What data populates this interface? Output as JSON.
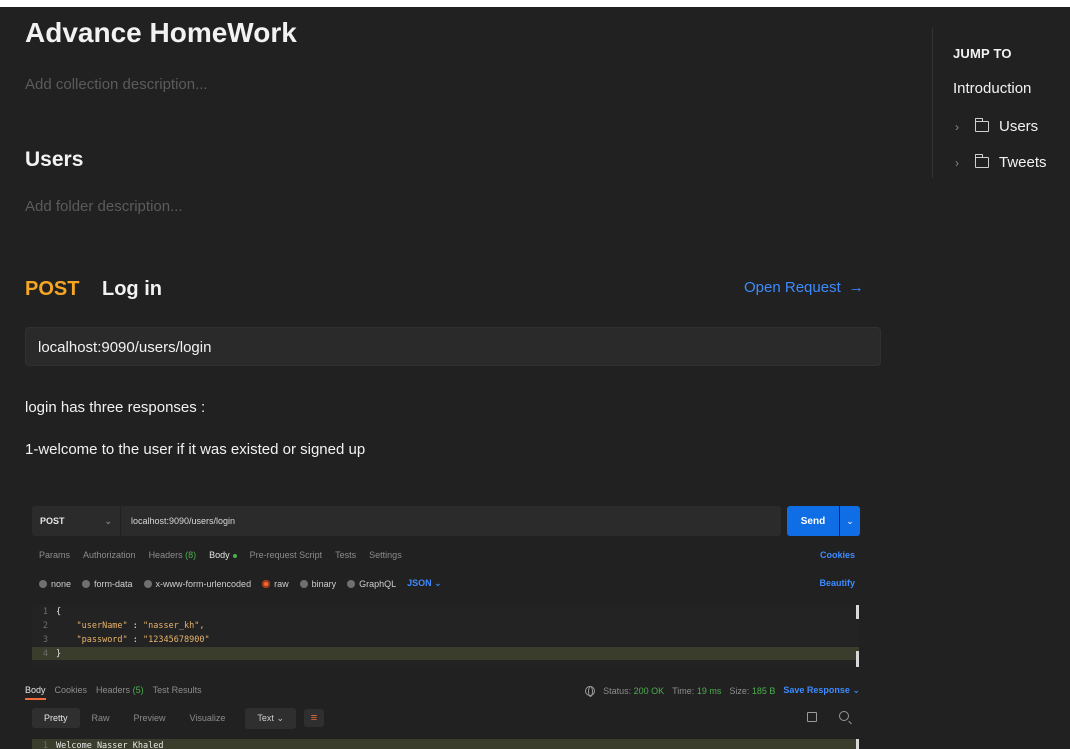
{
  "collection": {
    "title": "Advance HomeWork",
    "description_placeholder": "Add collection description..."
  },
  "folder": {
    "title": "Users",
    "description_placeholder": "Add folder description..."
  },
  "request": {
    "method": "POST",
    "name": "Log in",
    "open_label": "Open Request",
    "open_arrow": "→",
    "url": "localhost:9090/users/login",
    "description": [
      "login has three responses :",
      "1-welcome to the user if it was existed or signed up"
    ]
  },
  "sidebar": {
    "title": "JUMP TO",
    "intro": "Introduction",
    "items": [
      {
        "label": "Users"
      },
      {
        "label": "Tweets"
      }
    ]
  },
  "screenshot": {
    "method": "POST",
    "url": "localhost:9090/users/login",
    "send": "Send",
    "tabs": [
      {
        "label": "Params"
      },
      {
        "label": "Authorization"
      },
      {
        "label": "Headers",
        "count": "(8)"
      },
      {
        "label": "Body"
      },
      {
        "label": "Pre-request Script"
      },
      {
        "label": "Tests"
      },
      {
        "label": "Settings"
      }
    ],
    "cookies": "Cookies",
    "body_types": [
      "none",
      "form-data",
      "x-www-form-urlencoded",
      "raw",
      "binary",
      "GraphQL"
    ],
    "format": "JSON",
    "beautify": "Beautify",
    "code_lines": [
      {
        "n": "1",
        "text": "{"
      },
      {
        "n": "2",
        "key": "\"userName\"",
        "value": "\"nasser_kh\","
      },
      {
        "n": "3",
        "key": "\"password\"",
        "value": "\"12345678900\""
      },
      {
        "n": "4",
        "text": "}"
      }
    ],
    "resp_tabs": [
      {
        "label": "Body"
      },
      {
        "label": "Cookies"
      },
      {
        "label": "Headers",
        "count": "(5)"
      },
      {
        "label": "Test Results"
      }
    ],
    "status_label": "Status:",
    "status_value": "200 OK",
    "time_label": "Time:",
    "time_value": "19 ms",
    "size_label": "Size:",
    "size_value": "185 B",
    "save_response": "Save Response",
    "views": [
      "Pretty",
      "Raw",
      "Preview",
      "Visualize"
    ],
    "text_format": "Text",
    "response_line": {
      "n": "1",
      "text": "Welcome Nasser Khaled"
    }
  },
  "colors": {
    "method_post": "#f5a623",
    "link": "#3d8bff",
    "send": "#0f6ee6",
    "status_ok": "#4caf50"
  }
}
